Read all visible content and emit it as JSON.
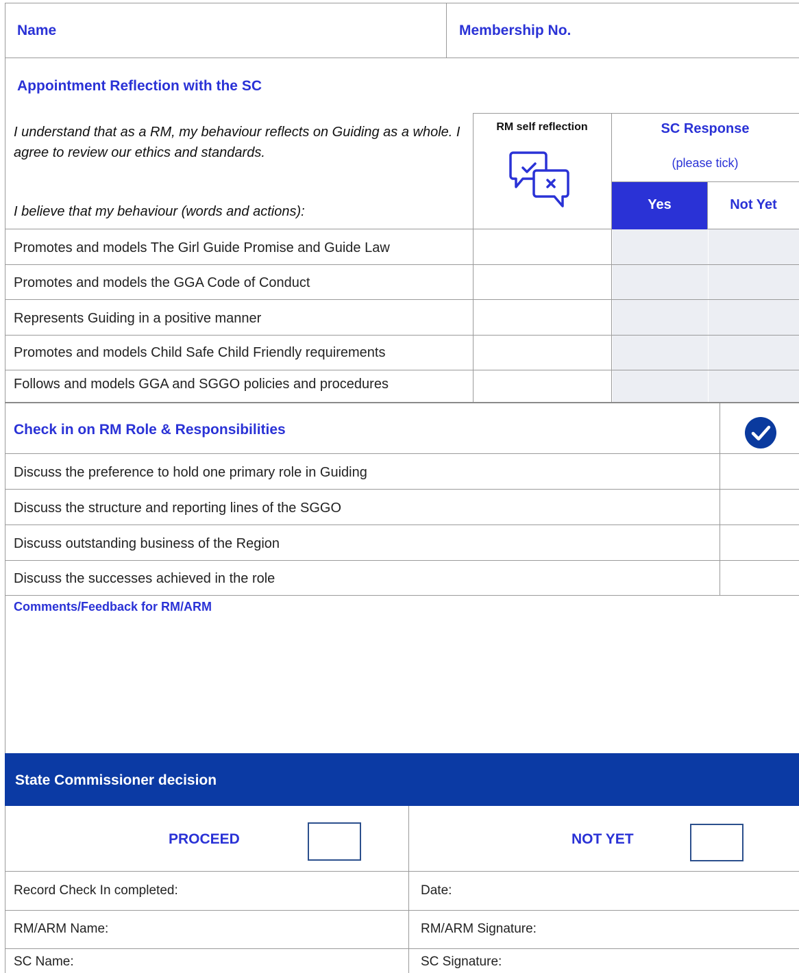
{
  "header": {
    "name_label": "Name",
    "membership_label": "Membership No."
  },
  "reflection": {
    "title": "Appointment Reflection with the SC",
    "statement": "I understand that as a RM, my behaviour reflects on Guiding as a whole. I agree to review our ethics and standards.",
    "belief": "I believe that my behaviour (words and actions):",
    "self_header": "RM self reflection",
    "self_icon": "chat-check-cross-icon",
    "sc_header": "SC Response",
    "sc_sub": "(please tick)",
    "yes_label": "Yes",
    "notyet_label": "Not Yet",
    "items": [
      "Promotes and models The Girl Guide Promise and Guide Law",
      "Promotes and models the GGA Code of Conduct",
      "Represents Guiding in a positive manner",
      "Promotes and models Child Safe Child Friendly requirements",
      "Follows and models GGA and SGGO policies and procedures"
    ]
  },
  "checkin": {
    "title": "Check in on RM Role & Responsibilities",
    "check_icon": "check-circle-icon",
    "items": [
      "Discuss the preference to hold one primary role in Guiding",
      "Discuss the structure and reporting lines of the SGGO",
      "Discuss outstanding business of the Region",
      "Discuss the successes achieved in the role"
    ]
  },
  "comments": {
    "label": "Comments/Feedback for RM/ARM",
    "value": ""
  },
  "decision": {
    "title": "State Commissioner decision",
    "proceed_label": "PROCEED",
    "notyet_label": "NOT YET",
    "rows": [
      {
        "left": "Record Check In completed:",
        "right": "Date:"
      },
      {
        "left": "RM/ARM Name:",
        "right": "RM/ARM Signature:"
      },
      {
        "left": "SC Name:",
        "right": "SC Signature:"
      }
    ]
  },
  "colors": {
    "accent_blue": "#2a32d6",
    "banner_navy": "#0b3aa4",
    "check_navy": "#0a3a9e",
    "cell_shade": "#eceef3"
  }
}
